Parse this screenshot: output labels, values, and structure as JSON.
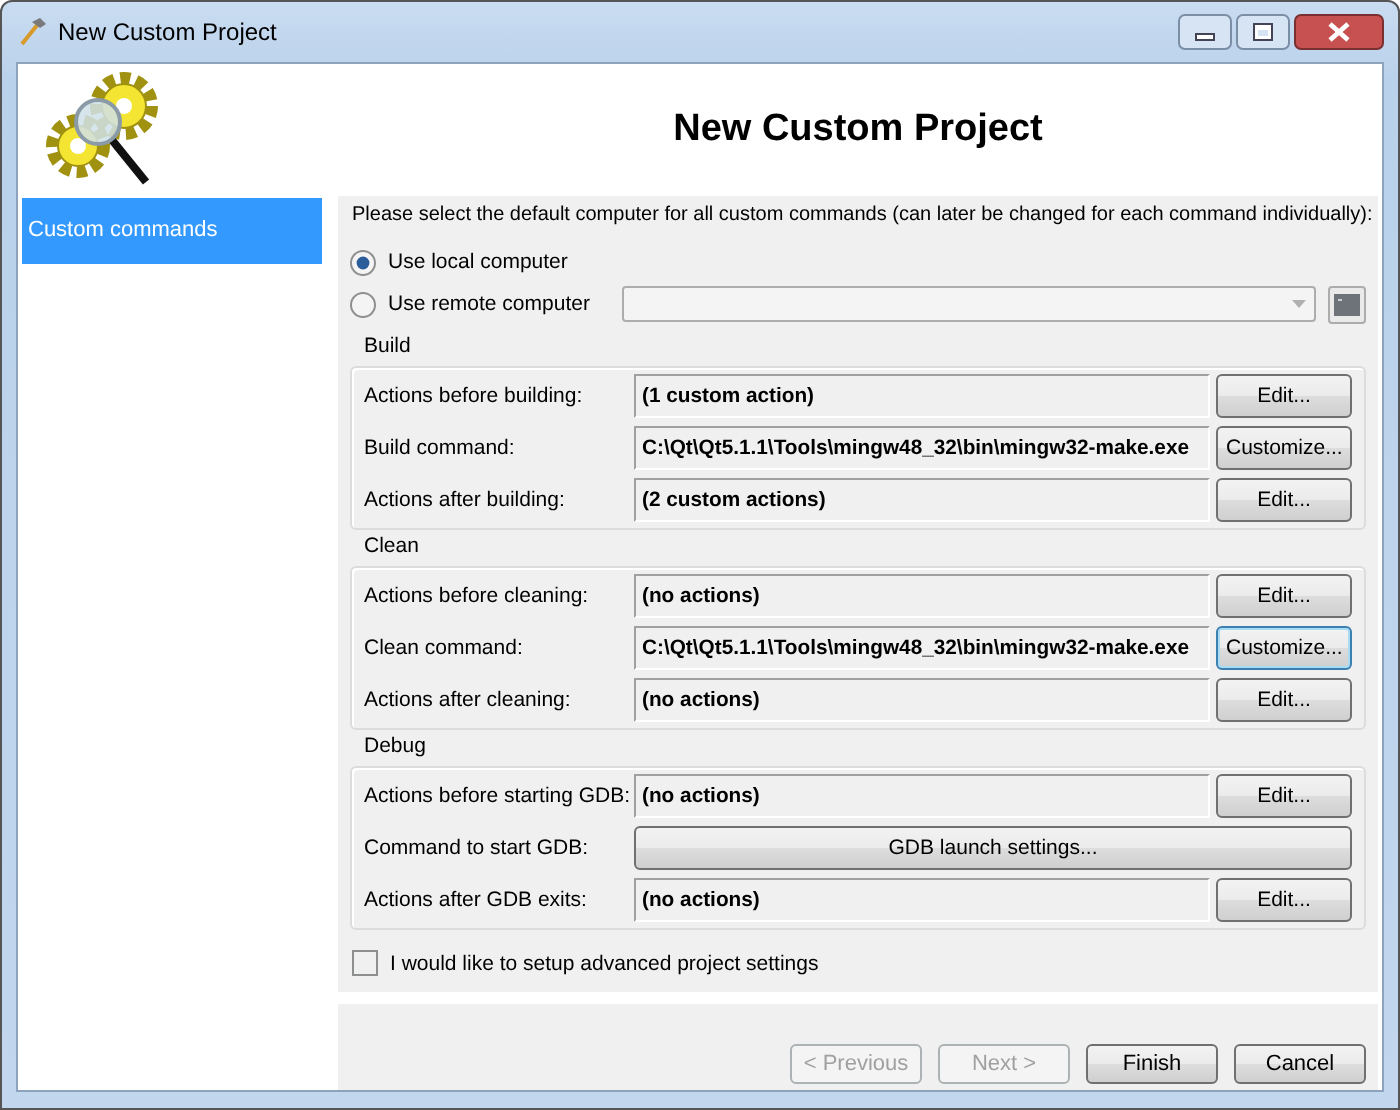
{
  "window": {
    "title": "New Custom Project"
  },
  "header": {
    "title": "New Custom Project"
  },
  "sidebar": {
    "items": [
      {
        "label": "Custom commands",
        "selected": true
      }
    ]
  },
  "intro": "Please select the default computer for all custom commands (can later be changed for each command individually):",
  "computer_options": [
    {
      "label": "Use local computer",
      "selected": true
    },
    {
      "label": "Use remote computer",
      "selected": false
    }
  ],
  "remote_computer": {
    "disabled": true
  },
  "groups": [
    {
      "title": "Build",
      "rows": [
        {
          "kind": "field",
          "label": "Actions before building:",
          "value": "(1 custom action)",
          "button": "Edit...",
          "focused": false
        },
        {
          "kind": "field",
          "label": "Build command:",
          "value": "C:\\Qt\\Qt5.1.1\\Tools\\mingw48_32\\bin\\mingw32-make.exe",
          "button": "Customize...",
          "focused": false
        },
        {
          "kind": "field",
          "label": "Actions after building:",
          "value": "(2 custom actions)",
          "button": "Edit...",
          "focused": false
        }
      ]
    },
    {
      "title": "Clean",
      "rows": [
        {
          "kind": "field",
          "label": "Actions before cleaning:",
          "value": "(no actions)",
          "button": "Edit...",
          "focused": false
        },
        {
          "kind": "field",
          "label": "Clean command:",
          "value": "C:\\Qt\\Qt5.1.1\\Tools\\mingw48_32\\bin\\mingw32-make.exe",
          "button": "Customize...",
          "focused": true
        },
        {
          "kind": "field",
          "label": "Actions after cleaning:",
          "value": "(no actions)",
          "button": "Edit...",
          "focused": false
        }
      ]
    },
    {
      "title": "Debug",
      "rows": [
        {
          "kind": "field",
          "label": "Actions before starting GDB:",
          "value": "(no actions)",
          "button": "Edit...",
          "focused": false
        },
        {
          "kind": "button",
          "label": "Command to start GDB:",
          "button": "GDB launch settings...",
          "focused": false
        },
        {
          "kind": "field",
          "label": "Actions after GDB exits:",
          "value": "(no actions)",
          "button": "Edit...",
          "focused": false
        }
      ]
    }
  ],
  "advanced": {
    "label": "I would like to setup advanced project settings",
    "checked": false
  },
  "buttons": [
    {
      "label": "< Previous",
      "disabled": true
    },
    {
      "label": "Next >",
      "disabled": true
    },
    {
      "label": "Finish",
      "disabled": false
    },
    {
      "label": "Cancel",
      "disabled": false
    }
  ]
}
